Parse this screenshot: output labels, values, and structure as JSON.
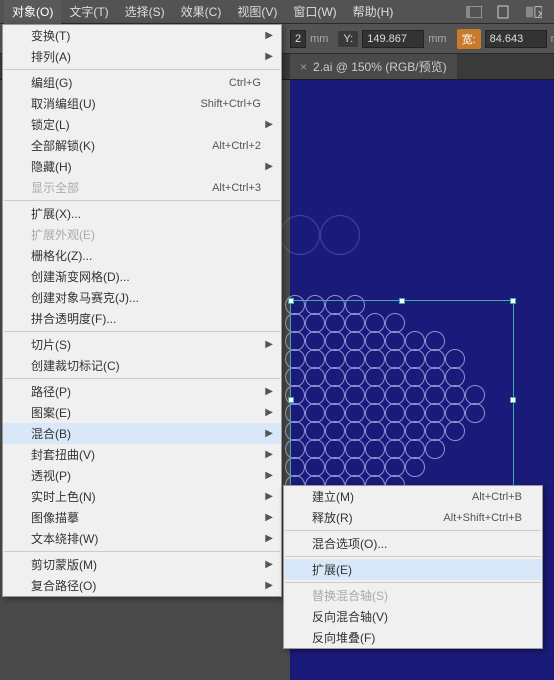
{
  "menubar": {
    "items": [
      "对象(O)",
      "文字(T)",
      "选择(S)",
      "效果(C)",
      "视图(V)",
      "窗口(W)",
      "帮助(H)"
    ]
  },
  "toolbar": {
    "y_prefix": "2",
    "y_label": "Y:",
    "y_value": "149.867",
    "unit": "mm",
    "w_label": "宽:",
    "w_value": "84.643"
  },
  "tab": {
    "title": "2.ai @ 150% (RGB/预览)",
    "close": "×"
  },
  "menu": {
    "transform": "变换(T)",
    "arrange": "排列(A)",
    "group": "编组(G)",
    "group_sc": "Ctrl+G",
    "ungroup": "取消编组(U)",
    "ungroup_sc": "Shift+Ctrl+G",
    "lock": "锁定(L)",
    "unlock_all": "全部解锁(K)",
    "unlock_all_sc": "Alt+Ctrl+2",
    "hide": "隐藏(H)",
    "show_all": "显示全部",
    "show_all_sc": "Alt+Ctrl+3",
    "expand": "扩展(X)...",
    "expand_appearance": "扩展外观(E)",
    "rasterize": "栅格化(Z)...",
    "gradient_mesh": "创建渐变网格(D)...",
    "object_mosaic": "创建对象马赛克(J)...",
    "flatten": "拼合透明度(F)...",
    "slice": "切片(S)",
    "trim_marks": "创建裁切标记(C)",
    "path": "路径(P)",
    "pattern": "图案(E)",
    "blend": "混合(B)",
    "envelope": "封套扭曲(V)",
    "perspective": "透视(P)",
    "live_paint": "实时上色(N)",
    "image_trace": "图像描摹",
    "text_wrap": "文本绕排(W)",
    "clipping_mask": "剪切蒙版(M)",
    "compound_path": "复合路径(O)"
  },
  "submenu": {
    "make": "建立(M)",
    "make_sc": "Alt+Ctrl+B",
    "release": "释放(R)",
    "release_sc": "Alt+Shift+Ctrl+B",
    "options": "混合选项(O)...",
    "expand": "扩展(E)",
    "replace_spine": "替换混合轴(S)",
    "reverse_spine": "反向混合轴(V)",
    "reverse_front": "反向堆叠(F)"
  }
}
